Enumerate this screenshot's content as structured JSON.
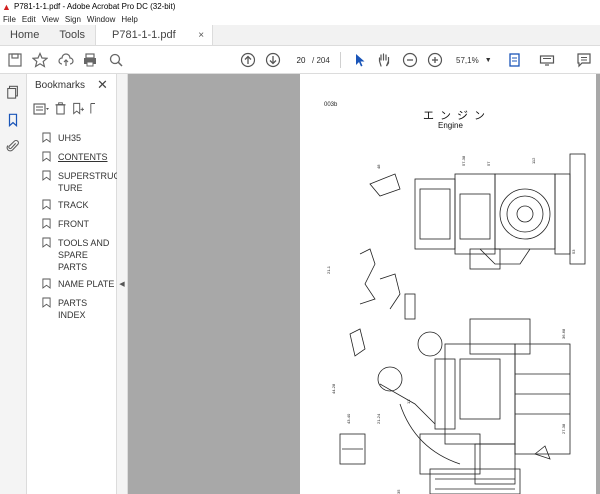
{
  "window": {
    "title": "P781-1-1.pdf - Adobe Acrobat Pro DC (32-bit)"
  },
  "menu": [
    "File",
    "Edit",
    "View",
    "Sign",
    "Window",
    "Help"
  ],
  "tabs": {
    "home": "Home",
    "tools": "Tools",
    "file": "P781-1-1.pdf",
    "close": "×"
  },
  "toolbar": {
    "page_current": "20",
    "page_total": "/ 204",
    "zoom": "57,1%"
  },
  "bookmarks": {
    "header": "Bookmarks",
    "close": "✕",
    "items": [
      {
        "label": "UH35",
        "underline": false
      },
      {
        "label": "CONTENTS",
        "underline": true
      },
      {
        "label": "SUPERSTRUC TURE",
        "underline": false
      },
      {
        "label": "TRACK",
        "underline": false
      },
      {
        "label": "FRONT",
        "underline": false
      },
      {
        "label": "TOOLS AND SPARE PARTS",
        "underline": false
      },
      {
        "label": "NAME PLATE",
        "underline": false
      },
      {
        "label": "PARTS INDEX",
        "underline": false
      }
    ]
  },
  "document": {
    "page_code": "003b",
    "title_jp": "エンジン",
    "title_en": "Engine"
  },
  "colors": {
    "canvas_bg": "#a8a8a8",
    "accent_blue": "#1473e6",
    "acrobat_red": "#d21f1f"
  }
}
